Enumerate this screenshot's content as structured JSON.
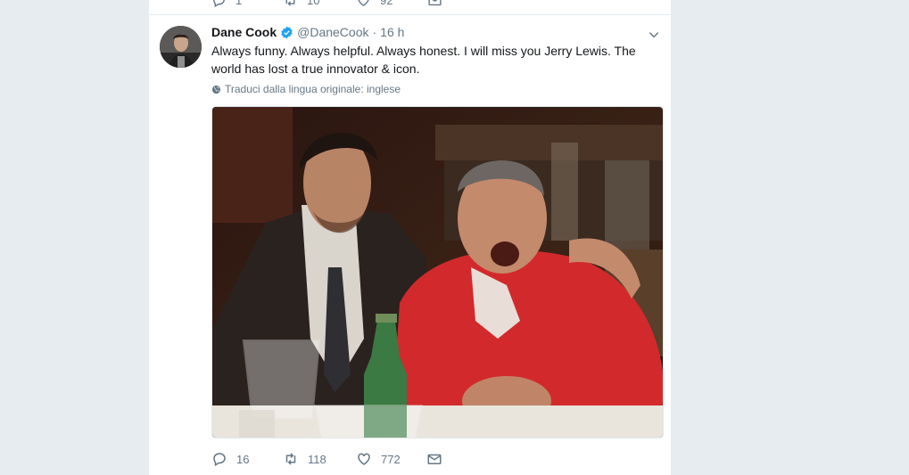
{
  "previous_tweet": {
    "reply_count": "1",
    "retweet_count": "10",
    "like_count": "92"
  },
  "tweet": {
    "author_name": "Dane Cook",
    "handle": "@DaneCook",
    "separator": "·",
    "time": "16 h",
    "text": "Always funny. Always helpful. Always honest. I will miss you Jerry Lewis. The world has lost a true innovator & icon.",
    "translate_label": "Traduci dalla lingua originale: inglese",
    "reply_count": "16",
    "retweet_count": "118",
    "like_count": "772"
  },
  "colors": {
    "background": "#e6ecf0",
    "verified": "#1da1f2",
    "secondary_text": "#657786",
    "primary_text": "#14171a"
  },
  "icons": [
    "reply-icon",
    "retweet-icon",
    "like-icon",
    "dm-icon",
    "verified-icon",
    "caret-down-icon",
    "globe-icon"
  ]
}
